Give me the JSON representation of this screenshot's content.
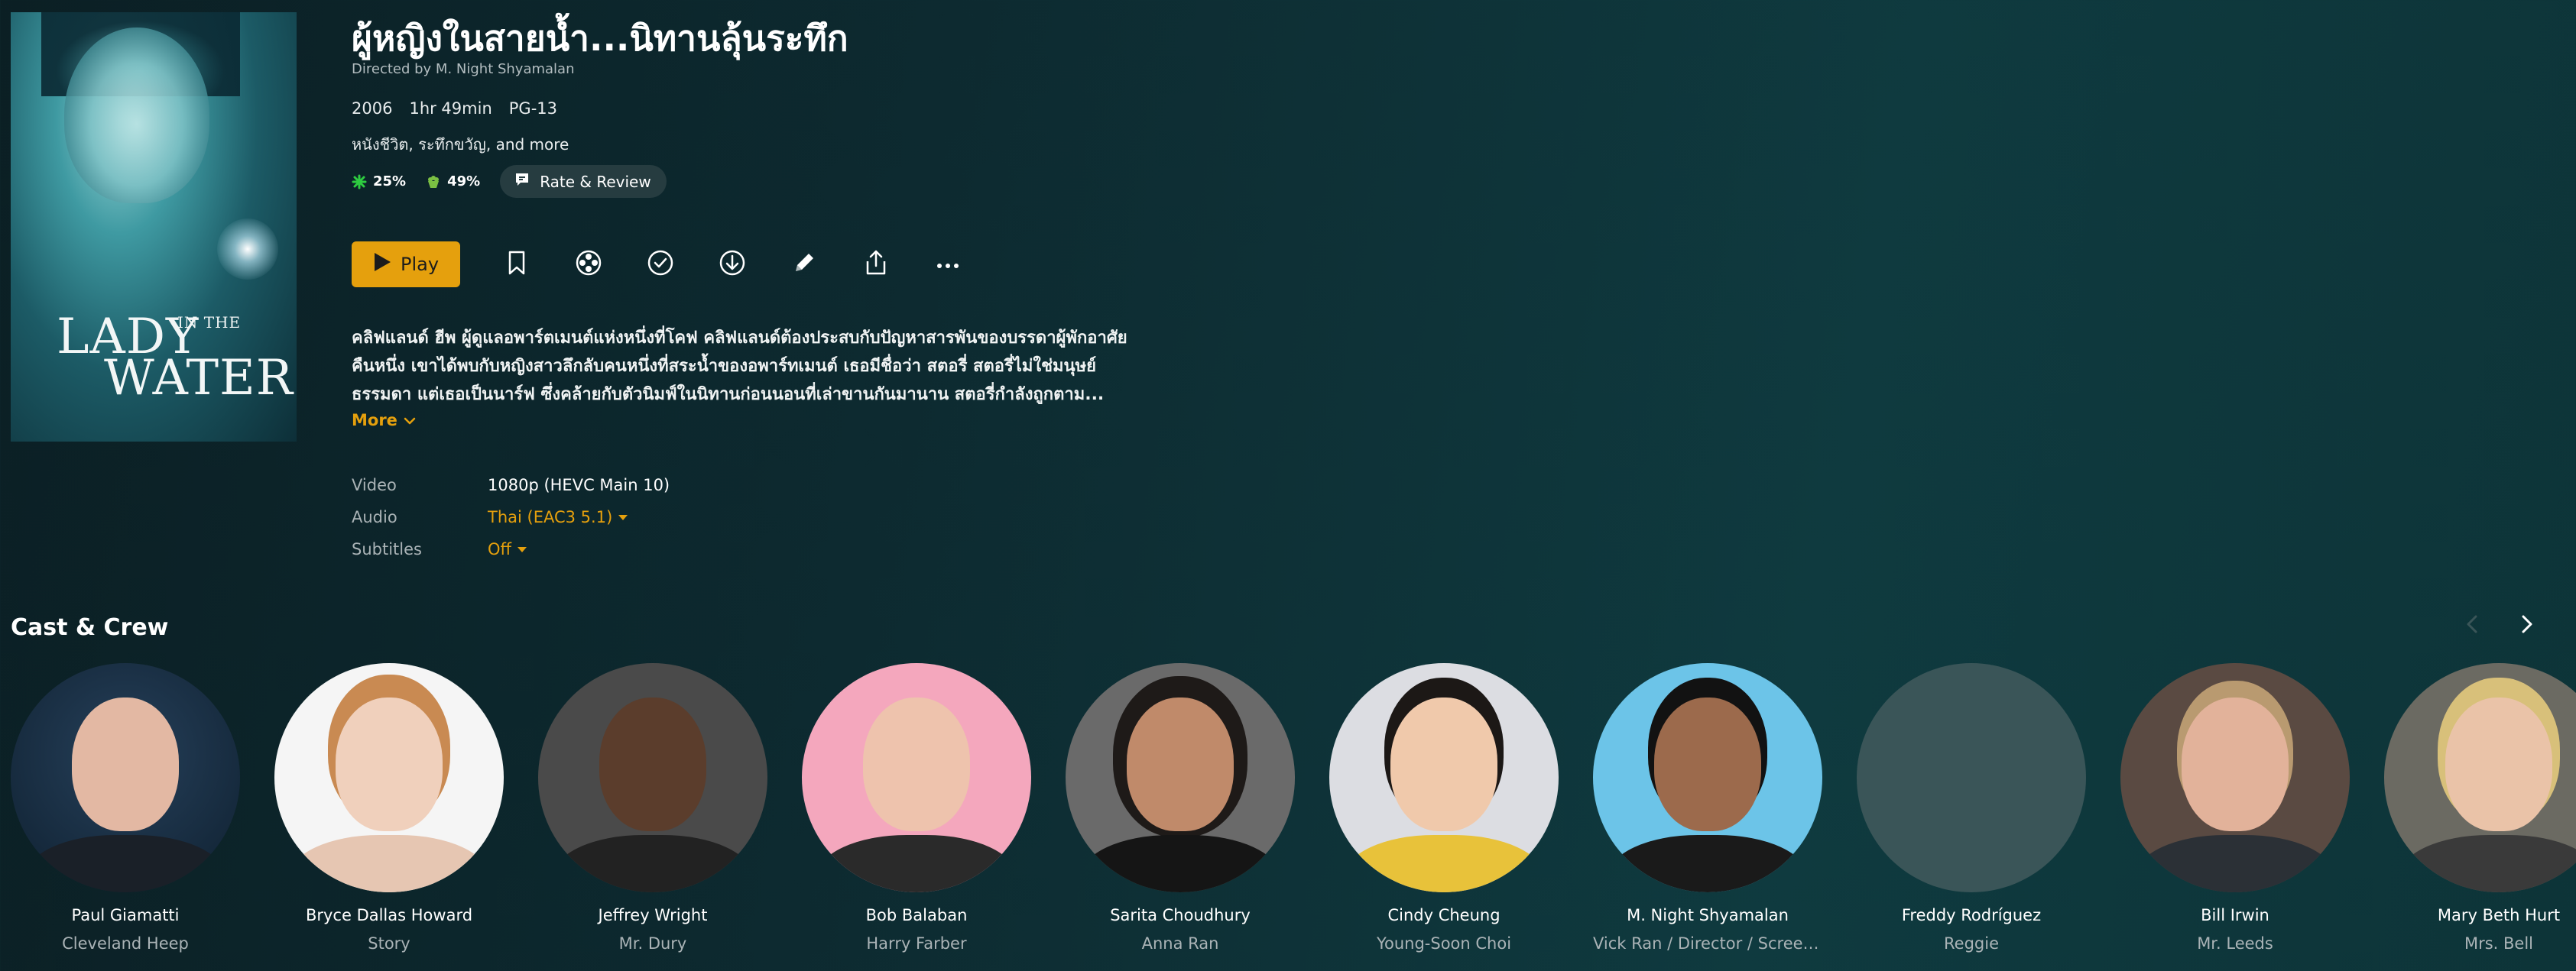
{
  "poster": {
    "alt": "Lady in the Water poster",
    "title_line1": "LADY",
    "title_in": "IN THE",
    "title_line2": "WATER"
  },
  "movie": {
    "title": "ผู้หญิงในสายน้ำ...นิทานลุ้นระทึก",
    "director": "Directed by M. Night Shyamalan",
    "year": "2006",
    "duration": "1hr 49min",
    "content_rating": "PG-13",
    "genres": "หนังชีวิต, ระทึกขวัญ, and more",
    "critic_score": "25%",
    "audience_score": "49%",
    "rate_review_label": "Rate & Review",
    "play_label": "Play",
    "description": "คลิฟแลนด์ ฮีพ ผู้ดูแลอพาร์ตเมนต์แห่งหนึ่งที่โคฟ คลิฟแลนด์ต้องประสบกับปัญหาสารพันของบรรดาผู้พักอาศัย คืนหนึ่ง เขาได้พบกับหญิงสาวลึกลับคนหนึ่งที่สระน้ำของอพาร์ทเมนต์ เธอมีชื่อว่า สตอรี่ สตอรี่ไม่ใช่มนุษย์ธรรมดา แต่เธอเป็นนาร์ฟ ซึ่งคล้ายกับตัวนิมฟ์ในนิทานก่อนนอนที่เล่าขานกันมานาน สตอรี่กำลังถูกตาม...",
    "more_label": "More"
  },
  "tech": {
    "video_label": "Video",
    "video_value": "1080p (HEVC Main 10)",
    "audio_label": "Audio",
    "audio_value": "Thai (EAC3 5.1)",
    "subtitles_label": "Subtitles",
    "subtitles_value": "Off"
  },
  "cast_section": {
    "title": "Cast & Crew",
    "people": [
      {
        "name": "Paul Giamatti",
        "role": "Cleveland Heep"
      },
      {
        "name": "Bryce Dallas Howard",
        "role": "Story"
      },
      {
        "name": "Jeffrey Wright",
        "role": "Mr. Dury"
      },
      {
        "name": "Bob Balaban",
        "role": "Harry Farber"
      },
      {
        "name": "Sarita Choudhury",
        "role": "Anna Ran"
      },
      {
        "name": "Cindy Cheung",
        "role": "Young-Soon Choi"
      },
      {
        "name": "M. Night Shyamalan",
        "role": "Vick Ran / Director / Screenpla..."
      },
      {
        "name": "Freddy Rodríguez",
        "role": "Reggie"
      },
      {
        "name": "Bill Irwin",
        "role": "Mr. Leeds"
      },
      {
        "name": "Mary Beth Hurt",
        "role": "Mrs. Bell"
      }
    ]
  },
  "icons": {
    "bookmark": "bookmark-icon",
    "film_reel": "film-reel-icon",
    "check": "check-circle-icon",
    "download": "download-icon",
    "edit": "edit-pencil-icon",
    "share": "share-icon",
    "more": "more-dots-icon"
  },
  "colors": {
    "accent": "#e5a00d",
    "background": "#0d2a30",
    "critic_green": "#2ecc40",
    "audience_green": "#7bc043"
  }
}
